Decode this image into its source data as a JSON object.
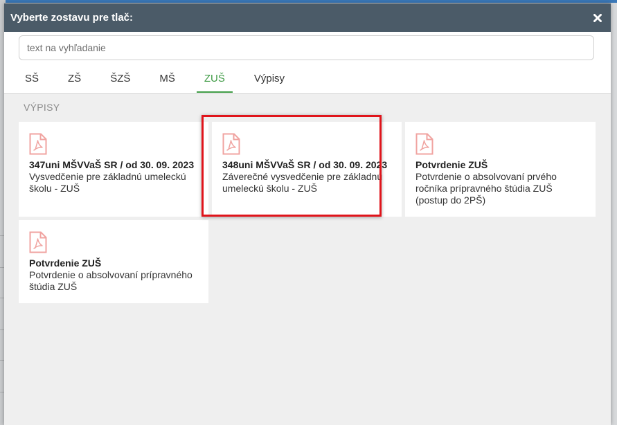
{
  "modal": {
    "title": "Vyberte zostavu pre tlač:"
  },
  "search": {
    "placeholder": "text na vyhľadanie",
    "value": ""
  },
  "tabs": [
    {
      "label": "SŠ",
      "active": false
    },
    {
      "label": "ZŠ",
      "active": false
    },
    {
      "label": "ŠZŠ",
      "active": false
    },
    {
      "label": "MŠ",
      "active": false
    },
    {
      "label": "ZUŠ",
      "active": true
    },
    {
      "label": "Výpisy",
      "active": false
    }
  ],
  "section": {
    "label": "VÝPISY"
  },
  "cards": [
    {
      "icon": "pdf-icon",
      "title": "347uni MŠVVaŠ SR / od 30. 09. 2023",
      "description": "Vysvedčenie pre základnú umeleckú školu - ZUŠ"
    },
    {
      "icon": "pdf-icon",
      "title": "348uni MŠVVaŠ SR / od 30. 09. 2023",
      "description": "Záverečné vysvedčenie pre základnú umeleckú školu - ZUŠ",
      "highlighted": true
    },
    {
      "icon": "pdf-icon",
      "title": "Potvrdenie ZUŠ",
      "description": "Potvrdenie o absolvovaní prvého ročníka prípravného štúdia ZUŠ (postup do 2PŠ)"
    },
    {
      "icon": "pdf-icon",
      "title": "Potvrdenie ZUŠ",
      "description": "Potvrdenie o absolvovaní prípravného štúdia ZUŠ"
    }
  ],
  "colors": {
    "header_bg": "#4b5b68",
    "active_tab": "#3f9b45",
    "highlight_border": "#e0141b",
    "pdf_icon": "#f0a3a0"
  }
}
